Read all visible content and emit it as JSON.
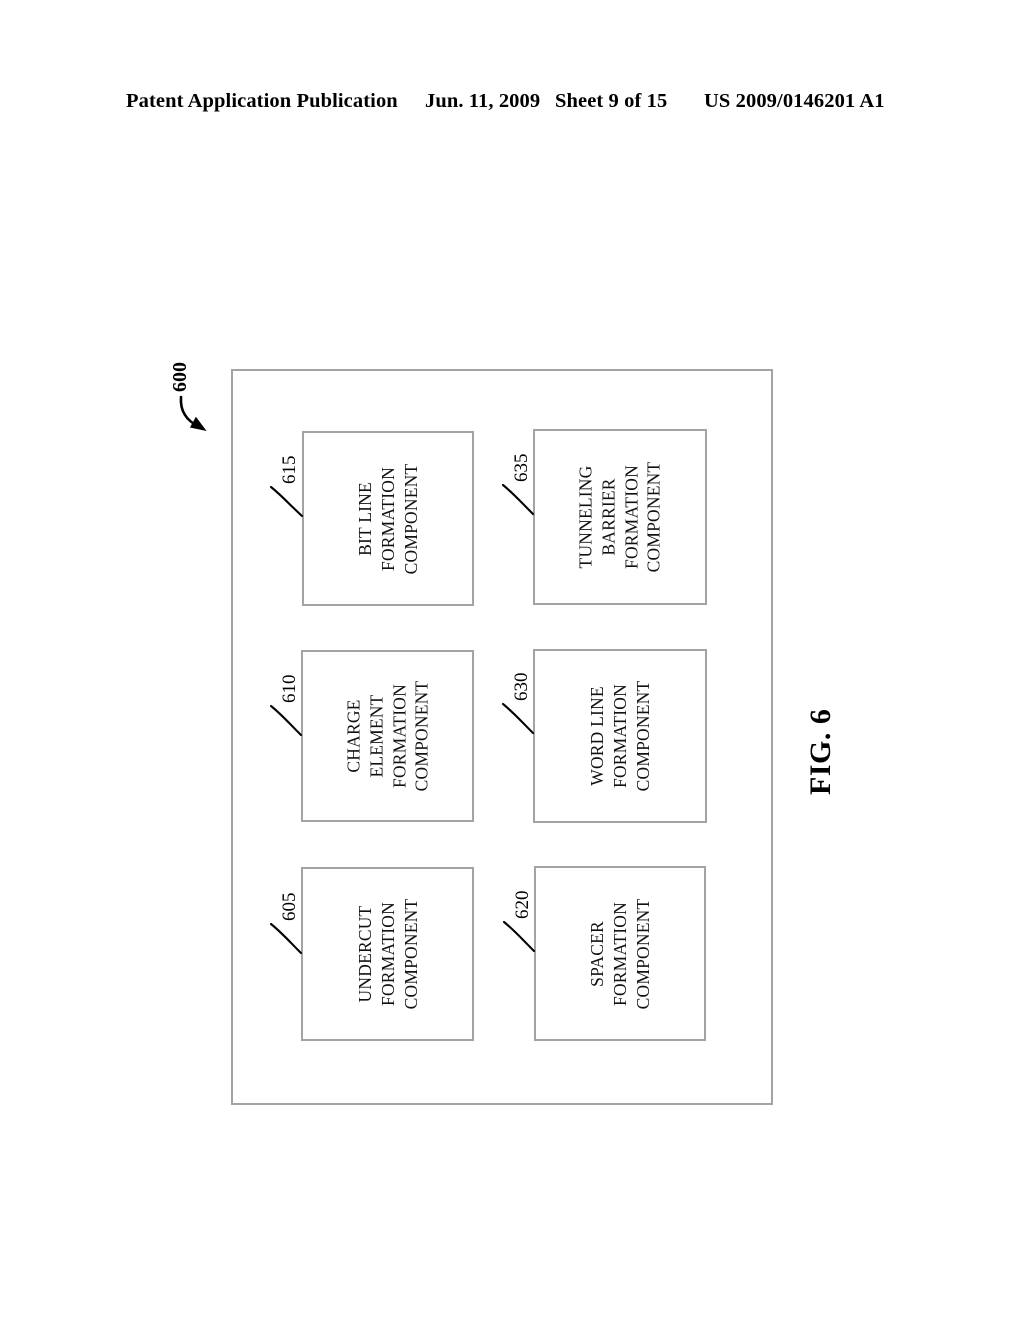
{
  "header": {
    "publication": "Patent Application Publication",
    "date": "Jun. 11, 2009",
    "sheet": "Sheet 9 of 15",
    "patent_number": "US 2009/0146201 A1"
  },
  "figure": {
    "caption": "FIG. 6",
    "system_ref": "600",
    "orientation_degrees": -90,
    "border_color": "#a3a3a3"
  },
  "components": [
    {
      "ref": "605",
      "name": "undercut-formation-component",
      "lines": [
        "UNDERCUT",
        "FORMATION",
        "COMPONENT"
      ]
    },
    {
      "ref": "610",
      "name": "charge-element-formation-component",
      "lines": [
        "CHARGE",
        "ELEMENT",
        "FORMATION",
        "COMPONENT"
      ]
    },
    {
      "ref": "615",
      "name": "bit-line-formation-component",
      "lines": [
        "BIT LINE",
        "FORMATION",
        "COMPONENT"
      ]
    },
    {
      "ref": "620",
      "name": "spacer-formation-component",
      "lines": [
        "SPACER",
        "FORMATION",
        "COMPONENT"
      ]
    },
    {
      "ref": "630",
      "name": "word-line-formation-component",
      "lines": [
        "WORD LINE",
        "FORMATION",
        "COMPONENT"
      ]
    },
    {
      "ref": "635",
      "name": "tunneling-barrier-formation-component",
      "lines": [
        "TUNNELING",
        "BARRIER",
        "FORMATION",
        "COMPONENT"
      ]
    }
  ]
}
